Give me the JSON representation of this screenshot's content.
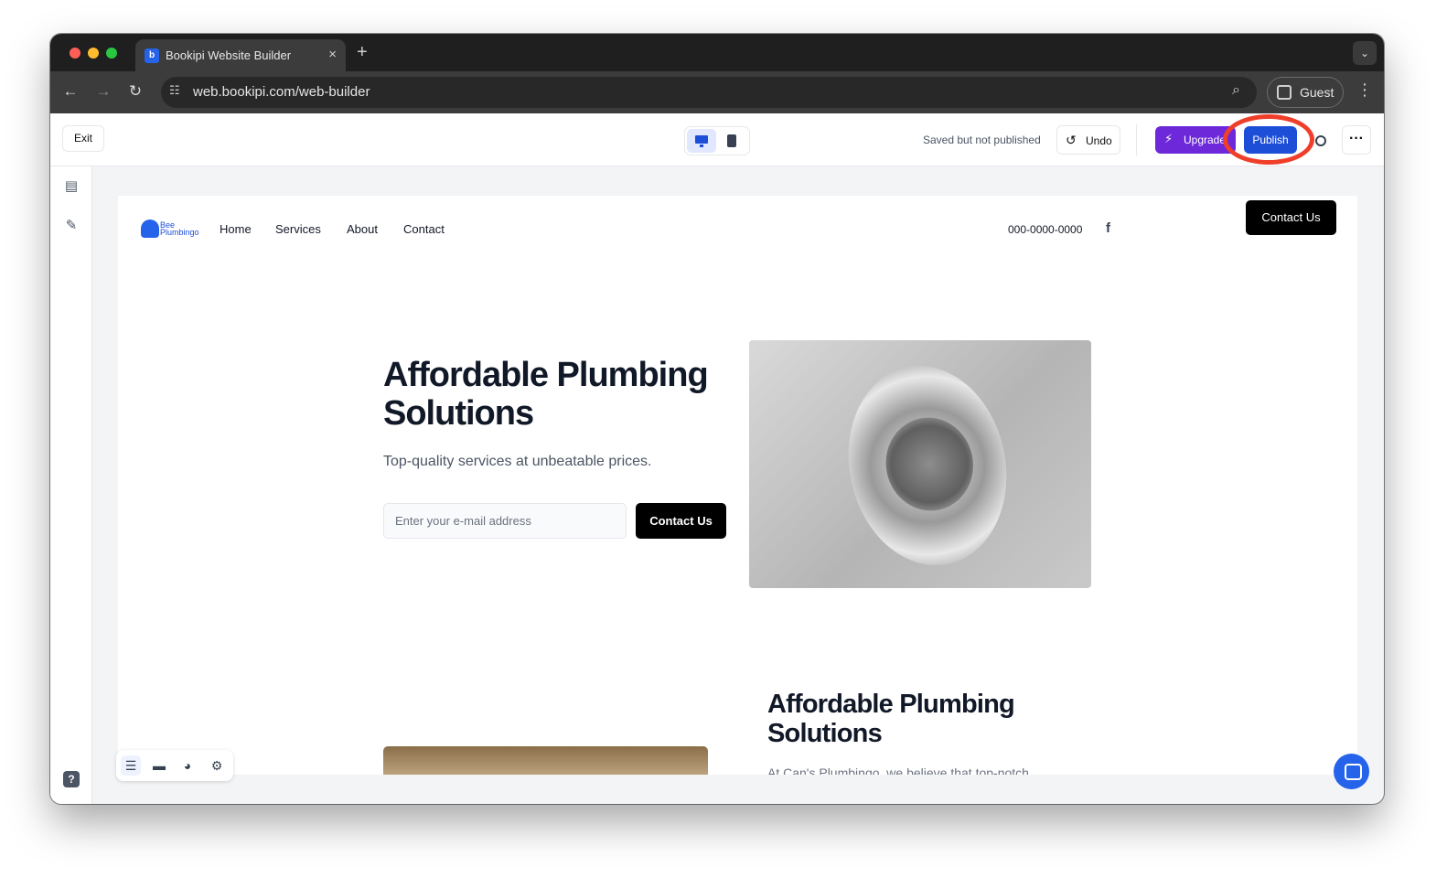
{
  "browser": {
    "tab_title": "Bookipi Website Builder",
    "tab_close": "×",
    "new_tab": "+",
    "url": "web.bookipi.com/web-builder",
    "profile_label": "Guest",
    "icons": [
      "back-icon",
      "forward-icon",
      "reload-icon",
      "site-info-icon",
      "zoom-icon",
      "profile-icon",
      "kebab-menu-icon",
      "tab-list-icon"
    ]
  },
  "builder": {
    "exit_label": "Exit",
    "status_text": "Saved but not published",
    "undo_label": "Undo",
    "upgrade_label": "Upgrade",
    "publish_label": "Publish",
    "highlight_color": "#ef3e2a",
    "accent_color": "#1d4ed8",
    "upgrade_color": "#6d28d9"
  },
  "site": {
    "logo_text_line1": "Bee",
    "logo_text_line2": "Plumbingo",
    "nav": [
      "Home",
      "Services",
      "About",
      "Contact"
    ],
    "phone": "000-0000-0000",
    "header_cta": "Contact Us",
    "hero": {
      "title": "Affordable Plumbing Solutions",
      "subtitle": "Top-quality services at unbeatable prices.",
      "email_placeholder": "Enter your e-mail address",
      "cta": "Contact Us"
    },
    "section2": {
      "title": "Affordable Plumbing Solutions",
      "text": "At Can's Plumbingo, we believe that top-notch"
    }
  }
}
